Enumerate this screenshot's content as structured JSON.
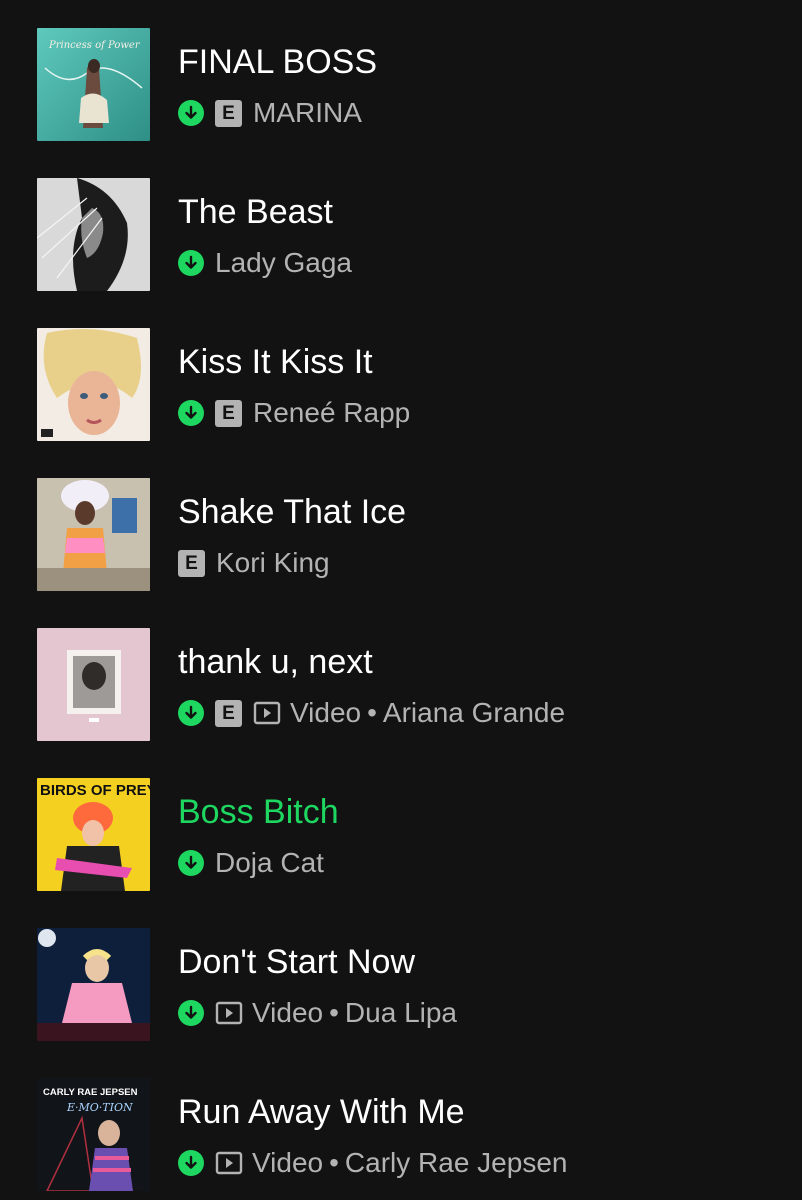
{
  "tracks": [
    {
      "title": "FINAL BOSS",
      "downloaded": true,
      "explicit": true,
      "explicit_label": "E",
      "video": false,
      "artist": "MARINA",
      "playing": false
    },
    {
      "title": "The Beast",
      "downloaded": true,
      "explicit": false,
      "video": false,
      "artist": "Lady Gaga",
      "playing": false
    },
    {
      "title": "Kiss It Kiss It",
      "downloaded": true,
      "explicit": true,
      "explicit_label": "E",
      "video": false,
      "artist": "Reneé Rapp",
      "playing": false
    },
    {
      "title": "Shake That Ice",
      "downloaded": false,
      "explicit": true,
      "explicit_label": "E",
      "video": false,
      "artist": "Kori King",
      "playing": false
    },
    {
      "title": "thank u, next",
      "downloaded": true,
      "explicit": true,
      "explicit_label": "E",
      "video": true,
      "video_label": "Video",
      "separator": "•",
      "artist": "Ariana Grande",
      "playing": false
    },
    {
      "title": "Boss Bitch",
      "downloaded": true,
      "explicit": false,
      "video": false,
      "artist": "Doja Cat",
      "playing": true
    },
    {
      "title": "Don't Start Now",
      "downloaded": true,
      "explicit": false,
      "video": true,
      "video_label": "Video",
      "separator": "•",
      "artist": "Dua Lipa",
      "playing": false
    },
    {
      "title": "Run Away With Me",
      "downloaded": true,
      "explicit": false,
      "video": true,
      "video_label": "Video",
      "separator": "•",
      "artist": "Carly Rae Jepsen",
      "playing": false
    }
  ],
  "covers": {
    "final_boss_script": "Princess of Power",
    "birds_of_prey_text": "BIRDS OF PREY",
    "carly_rae_jepsen_text": "CARLY RAE JEPSEN",
    "emotion_text": "E·MO·TION"
  },
  "colors": {
    "background": "#121212",
    "accent_green": "#1ed760",
    "secondary_text": "#b3b3b3"
  },
  "icons": {
    "download": "download-arrow-icon",
    "explicit": "explicit-badge",
    "video": "video-play-icon"
  }
}
